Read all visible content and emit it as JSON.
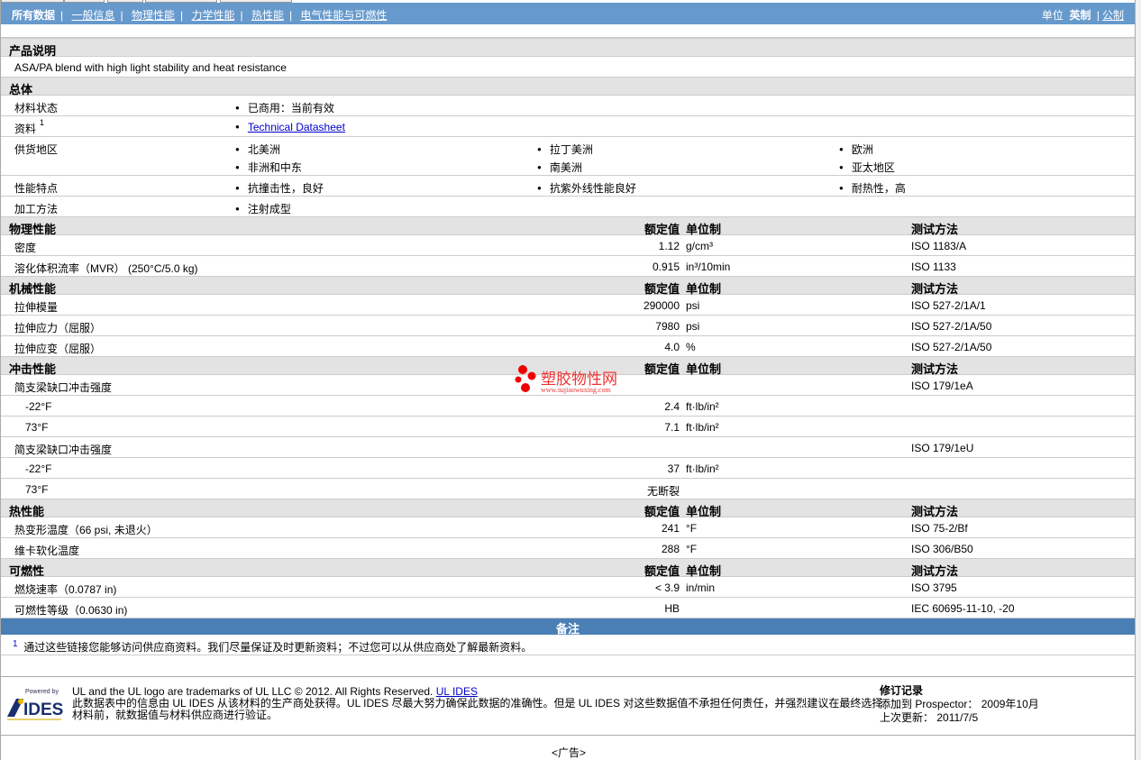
{
  "nav": {
    "tabs": [
      "所有数据",
      "一般信息",
      "物理性能",
      "力学性能",
      "热性能",
      "电气性能与可燃性"
    ],
    "units_label": "单位",
    "unit_active": "英制",
    "unit_other": "公制"
  },
  "colors": {
    "nav": "#6699cc",
    "notes": "#4a7fb5",
    "header": "#e3e3e3"
  },
  "product": {
    "header": "产品说明",
    "description": "ASA/PA blend with high light stability and heat resistance"
  },
  "general": {
    "header": "总体",
    "rows": [
      {
        "label": "材料状态",
        "items": [
          "已商用：当前有效"
        ]
      },
      {
        "label": "资料",
        "sup": "1",
        "link": "Technical Datasheet"
      },
      {
        "label": "供货地区",
        "items": [
          "北美洲",
          "拉丁美洲",
          "欧洲",
          "非洲和中东",
          "南美洲",
          "亚太地区"
        ]
      },
      {
        "label": "性能特点",
        "items": [
          "抗撞击性，良好",
          "抗紫外线性能良好",
          "耐热性，高"
        ]
      },
      {
        "label": "加工方法",
        "items": [
          "注射成型"
        ]
      }
    ]
  },
  "col_headers": {
    "value": "额定值",
    "unit": "单位制",
    "method": "测试方法"
  },
  "sections": [
    {
      "title": "物理性能",
      "rows": [
        {
          "label": "密度",
          "value": "1.12",
          "unit": "g/cm³",
          "method": "ISO 1183/A"
        },
        {
          "label": "溶化体积流率（MVR） (250°C/5.0 kg)",
          "value": "0.915",
          "unit": "in³/10min",
          "method": "ISO 1133"
        }
      ]
    },
    {
      "title": "机械性能",
      "rows": [
        {
          "label": "拉伸模量",
          "value": "290000",
          "unit": "psi",
          "method": "ISO 527-2/1A/1"
        },
        {
          "label": "拉伸应力（屈服）",
          "value": "7980",
          "unit": "psi",
          "method": "ISO 527-2/1A/50"
        },
        {
          "label": "拉伸应变（屈服）",
          "value": "4.0",
          "unit": "%",
          "method": "ISO 527-2/1A/50"
        }
      ]
    },
    {
      "title": "冲击性能",
      "rows": [
        {
          "label": "简支梁缺口冲击强度",
          "value": "",
          "unit": "",
          "method": "ISO 179/1eA"
        },
        {
          "sub": "-22°F",
          "value": "2.4",
          "unit": "ft·lb/in²",
          "method": ""
        },
        {
          "sub": "73°F",
          "value": "7.1",
          "unit": "ft·lb/in²",
          "method": ""
        },
        {
          "label": "简支梁缺口冲击强度",
          "value": "",
          "unit": "",
          "method": "ISO 179/1eU"
        },
        {
          "sub": "-22°F",
          "value": "37",
          "unit": "ft·lb/in²",
          "method": ""
        },
        {
          "sub": "73°F",
          "value": "无断裂",
          "unit": "",
          "method": ""
        }
      ]
    },
    {
      "title": "热性能",
      "rows": [
        {
          "label": "热变形温度（66 psi, 未退火）",
          "value": "241",
          "unit": "°F",
          "method": "ISO 75-2/Bf"
        },
        {
          "label": "维卡软化温度",
          "value": "288",
          "unit": "°F",
          "method": "ISO 306/B50"
        }
      ]
    },
    {
      "title": "可燃性",
      "rows": [
        {
          "label": "燃烧速率（0.0787 in)",
          "value": "< 3.9",
          "unit": "in/min",
          "method": "ISO 3795"
        },
        {
          "label": "可燃性等级（0.0630 in)",
          "value": "HB",
          "unit": "",
          "method": "IEC 60695-11-10, -20"
        }
      ]
    }
  ],
  "notes": {
    "title": "备注",
    "footnote_num": "1",
    "footnote": "通过这些链接您能够访问供应商资料。我们尽量保证及时更新资料；不过您可以从供应商处了解最新资料。"
  },
  "footer": {
    "logo_text": "Powered by IDES",
    "trademark": "UL and the UL logo are trademarks of UL LLC © 2012. All Rights Reserved.",
    "trademark_link": "UL IDES",
    "disclaimer": "此数据表中的信息由 UL IDES 从该材料的生产商处获得。UL IDES 尽最大努力确保此数据的准确性。但是 UL IDES 对这些数据值不承担任何责任，并强烈建议在最终选择材料前，就数据值与材料供应商进行验证。",
    "revision_title": "修订记录",
    "added_label": "添加到 Prospector：",
    "added_value": "2009年10月",
    "updated_label": "上次更新：",
    "updated_value": "2011/7/5"
  },
  "ad": "<广告>",
  "watermark": {
    "name": "塑胶物性网",
    "url": "www.sujiaowuxing.com"
  }
}
